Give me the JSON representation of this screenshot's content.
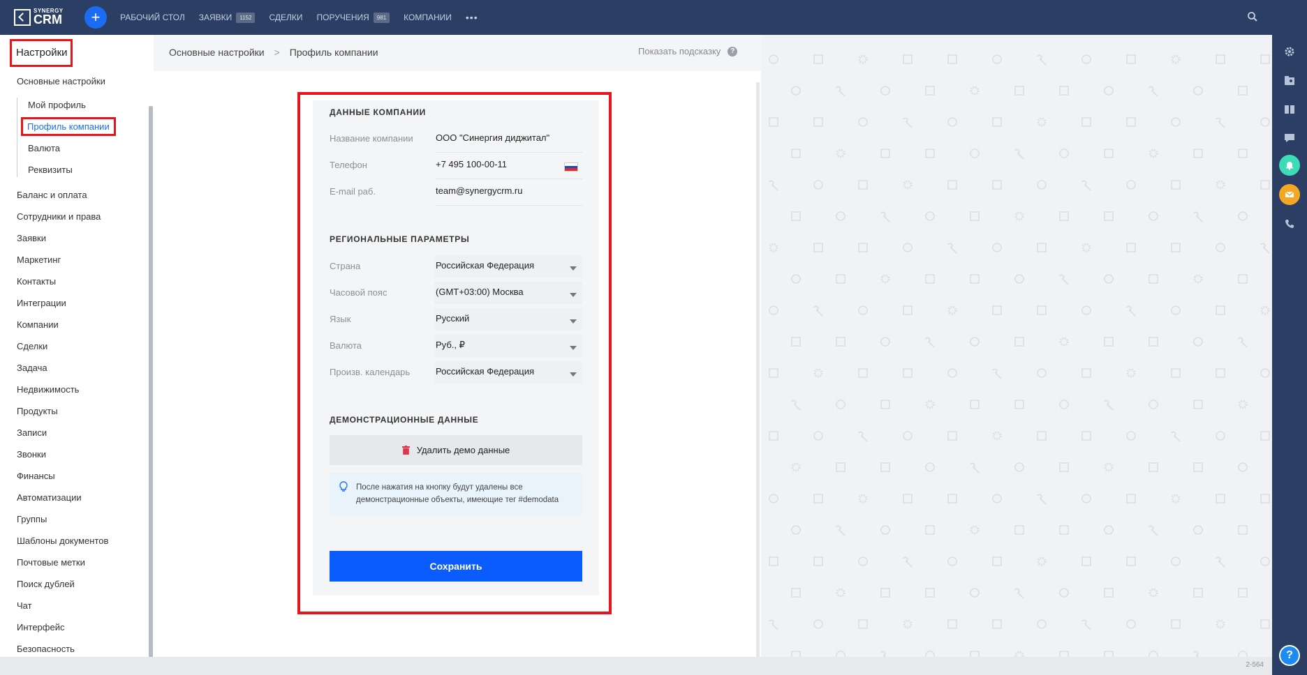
{
  "app": {
    "logo_small": "SYNERGY",
    "logo_big": "CRM"
  },
  "nav": {
    "add_icon": "plus-icon",
    "items": [
      {
        "label": "РАБОЧИЙ СТОЛ",
        "badge": ""
      },
      {
        "label": "ЗАЯВКИ",
        "badge": "1152"
      },
      {
        "label": "СДЕЛКИ",
        "badge": ""
      },
      {
        "label": "ПОРУЧЕНИЯ",
        "badge": "981"
      },
      {
        "label": "КОМПАНИИ",
        "badge": ""
      }
    ],
    "more": "•••"
  },
  "sidebar": {
    "title": "Настройки",
    "main_top": "Основные настройки",
    "subitems": [
      "Мой профиль",
      "Профиль компании",
      "Валюта",
      "Реквизиты"
    ],
    "active_sub": "Профиль компании",
    "items": [
      "Баланс и оплата",
      "Сотрудники и права",
      "Заявки",
      "Маркетинг",
      "Контакты",
      "Интеграции",
      "Компании",
      "Сделки",
      "Задача",
      "Недвижимость",
      "Продукты",
      "Записи",
      "Звонки",
      "Финансы",
      "Автоматизации",
      "Группы",
      "Шаблоны документов",
      "Почтовые метки",
      "Поиск дублей",
      "Чат",
      "Интерфейс",
      "Безопасность"
    ]
  },
  "header": {
    "breadcrumb_root": "Основные настройки",
    "breadcrumb_sep": ">",
    "breadcrumb_current": "Профиль компании",
    "hint": "Показать подсказку",
    "hint_icon": "?"
  },
  "company": {
    "section_title": "ДАННЫЕ КОМПАНИИ",
    "name_label": "Название компании",
    "name_value": "ООО \"Синергия диджитал\"",
    "phone_label": "Телефон",
    "phone_value": "+7 495 100-00-11",
    "email_label": "E-mail раб.",
    "email_value": "team@synergycrm.ru"
  },
  "regional": {
    "section_title": "РЕГИОНАЛЬНЫЕ ПАРАМЕТРЫ",
    "country_label": "Страна",
    "country_value": "Российская Федерация",
    "tz_label": "Часовой пояс",
    "tz_value": "(GMT+03:00) Москва",
    "lang_label": "Язык",
    "lang_value": "Русский",
    "currency_label": "Валюта",
    "currency_value": "Руб., ₽",
    "calendar_label": "Произв. календарь",
    "calendar_value": "Российская Федерация"
  },
  "demo": {
    "section_title": "ДЕМОНСТРАЦИОННЫЕ ДАННЫЕ",
    "delete_label": "Удалить демо данные",
    "info_line1": "После нажатия на кнопку будут удалены все",
    "info_line2": "демонстрационные объекты, имеющие тег #demodata"
  },
  "save_label": "Сохранить",
  "version": "2-564",
  "colors": {
    "topbar": "#2b3e63",
    "accent": "#1c6cf3",
    "save": "#0b5cff",
    "highlight": "#e8141b",
    "bell": "#3ddbb8",
    "mail": "#f5a623"
  }
}
